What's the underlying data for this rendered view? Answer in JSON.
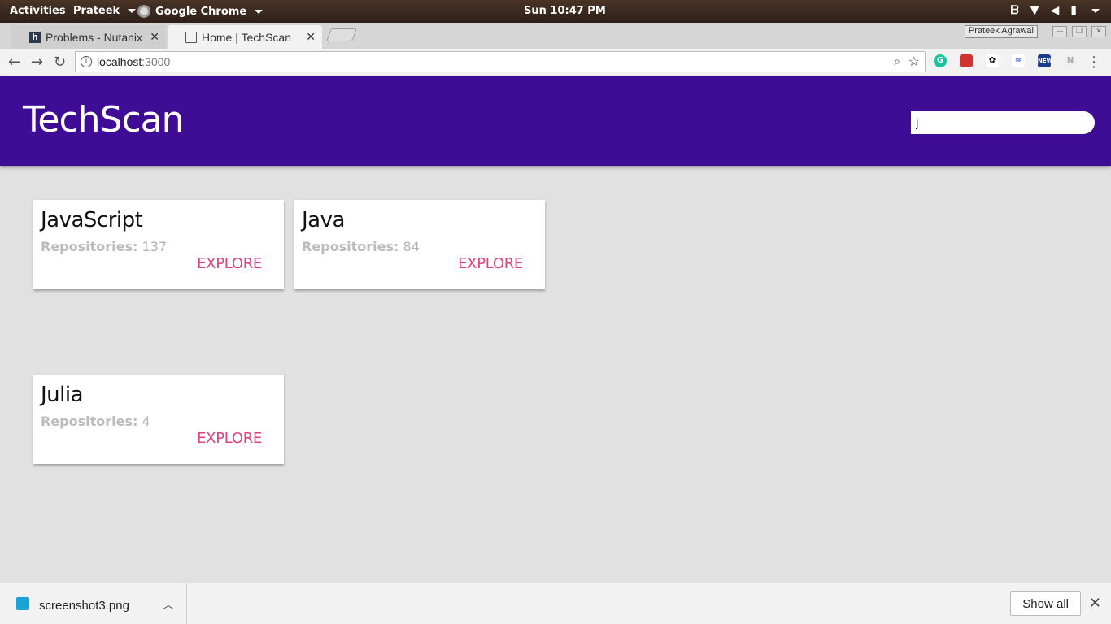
{
  "system": {
    "activities": "Activities",
    "user": "Prateek",
    "app": "Google Chrome",
    "clock": "Sun 10:47 PM"
  },
  "browser": {
    "tabs": [
      {
        "title": "Problems - Nutanix",
        "active": false
      },
      {
        "title": "Home | TechScan",
        "active": true
      }
    ],
    "profile_name": "Prateek Agrawal",
    "url_host": "localhost",
    "url_port": ":3000"
  },
  "app": {
    "brand": "TechScan",
    "search_value": "j",
    "header_color": "#3f0c96",
    "accent_color": "#e0407b"
  },
  "cards": [
    {
      "language": "JavaScript",
      "repos_label": "Repositories:",
      "repos_count": "137",
      "action": "EXPLORE"
    },
    {
      "language": "Java",
      "repos_label": "Repositories:",
      "repos_count": "84",
      "action": "EXPLORE"
    },
    {
      "language": "Julia",
      "repos_label": "Repositories:",
      "repos_count": "4",
      "action": "EXPLORE"
    }
  ],
  "downloads": {
    "file": "screenshot3.png",
    "show_all": "Show all"
  }
}
